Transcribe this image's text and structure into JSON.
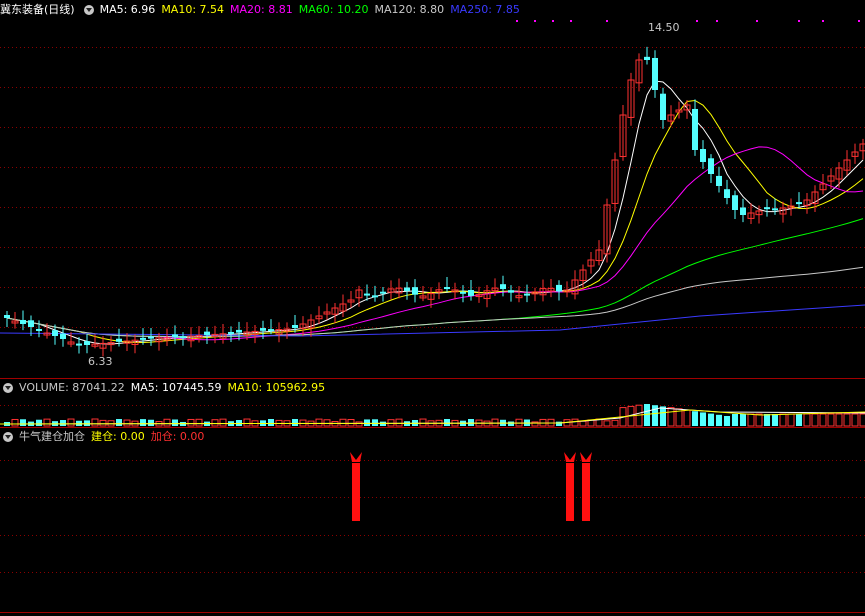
{
  "main_legend": {
    "title": "冀东装备(日线)",
    "items": [
      {
        "label": "MA5: 6.96",
        "color": "#ffffff"
      },
      {
        "label": "MA10: 7.54",
        "color": "#ffff00"
      },
      {
        "label": "MA20: 8.81",
        "color": "#ff00ff"
      },
      {
        "label": "MA60: 10.20",
        "color": "#00ff00"
      },
      {
        "label": "MA120: 8.80",
        "color": "#c8c8c8"
      },
      {
        "label": "MA250: 7.85",
        "color": "#3a3aff"
      }
    ]
  },
  "volume_legend": {
    "items": [
      {
        "label": "VOLUME: 87041.22",
        "color": "#c8c8c8"
      },
      {
        "label": "MA5: 107445.59",
        "color": "#ffffff"
      },
      {
        "label": "MA10: 105962.95",
        "color": "#ffff00"
      }
    ]
  },
  "indicator_legend": {
    "title": "牛气建仓加仓",
    "items": [
      {
        "label": "建仓: 0.00",
        "color": "#ffff00"
      },
      {
        "label": "加仓: 0.00",
        "color": "#ff3030"
      }
    ]
  },
  "price_labels": {
    "high": "14.50",
    "low": "6.33"
  },
  "colors": {
    "up": "#ff3232",
    "down": "#54ffff",
    "grid": "#8b0000",
    "border": "#a00000",
    "signal": "#ff1010"
  }
}
